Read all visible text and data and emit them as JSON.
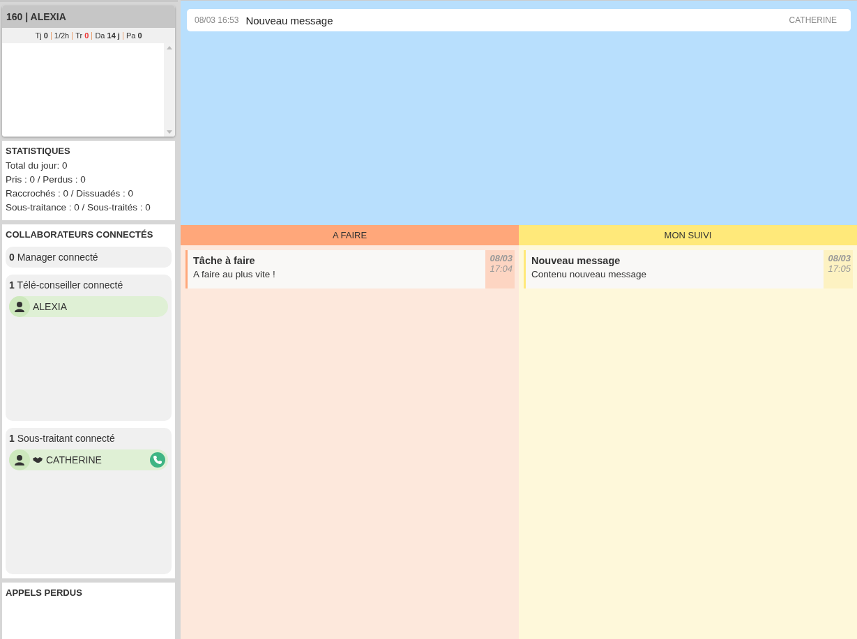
{
  "profile": {
    "title": "160 | ALEXIA",
    "counters": [
      {
        "label": "Tj",
        "value": "0",
        "alert": false
      },
      {
        "label": "1/2h"
      },
      {
        "label": "Tr",
        "value": "0",
        "alert": true
      },
      {
        "label": "Da",
        "value": "14 j",
        "alert": false
      },
      {
        "label": "Pa",
        "value": "0",
        "alert": false
      }
    ]
  },
  "statistics": {
    "title": "STATISTIQUES",
    "lines": [
      "Total du jour: 0",
      "Pris : 0 / Perdus : 0",
      "Raccrochés : 0 / Dissuadés : 0",
      "Sous-traitance : 0 / Sous-traités : 0"
    ]
  },
  "collaborators": {
    "title": "COLLABORATEURS CONNECTÉS",
    "groups": [
      {
        "count": "0",
        "label": "Manager connecté"
      },
      {
        "count": "1",
        "label": "Télé-conseiller connecté",
        "members": [
          {
            "name": "ALEXIA",
            "subcontractor": false,
            "call": false
          }
        ]
      },
      {
        "count": "1",
        "label": "Sous-traitant connecté",
        "members": [
          {
            "name": "CATHERINE",
            "subcontractor": true,
            "call": true
          }
        ]
      }
    ]
  },
  "missed_calls": {
    "title": "APPELS PERDUS"
  },
  "message": {
    "datetime": "08/03 16:53",
    "text": "Nouveau message",
    "author": "CATHERINE"
  },
  "columns": [
    {
      "title": "A FAIRE",
      "kind": "todo",
      "cards": [
        {
          "title": "Tâche à faire",
          "body": "A faire au plus vite !",
          "date": "08/03",
          "time": "17:04"
        }
      ]
    },
    {
      "title": "MON SUIVI",
      "kind": "follow",
      "cards": [
        {
          "title": "Nouveau message",
          "body": "Contenu nouveau message",
          "date": "08/03",
          "time": "17:05"
        }
      ]
    }
  ]
}
